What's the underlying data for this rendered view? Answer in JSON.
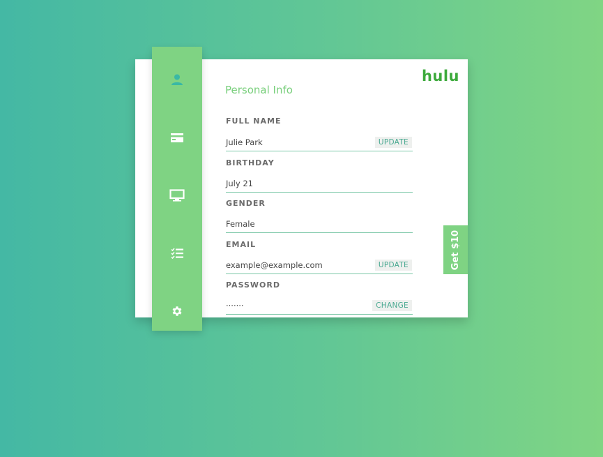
{
  "brand": {
    "name": "hulu",
    "color": "#3daa3c"
  },
  "sidebar": {
    "background": "#7fd383",
    "items": [
      {
        "icon": "user-icon",
        "active": true
      },
      {
        "icon": "credit-card-icon",
        "active": false
      },
      {
        "icon": "monitor-icon",
        "active": false
      },
      {
        "icon": "checklist-icon",
        "active": false
      },
      {
        "icon": "gear-icon",
        "active": false
      }
    ]
  },
  "page": {
    "title": "Personal Info",
    "fields": [
      {
        "label": "FULL NAME",
        "value": "Julie Park",
        "action": "UPDATE"
      },
      {
        "label": "BIRTHDAY",
        "value": "July 21",
        "action": ""
      },
      {
        "label": "GENDER",
        "value": "Female",
        "action": ""
      },
      {
        "label": "EMAIL",
        "value": "example@example.com",
        "action": "UPDATE"
      },
      {
        "label": "PASSWORD",
        "value": "·······",
        "action": "CHANGE"
      }
    ]
  },
  "promo": {
    "label": "Get $10"
  }
}
